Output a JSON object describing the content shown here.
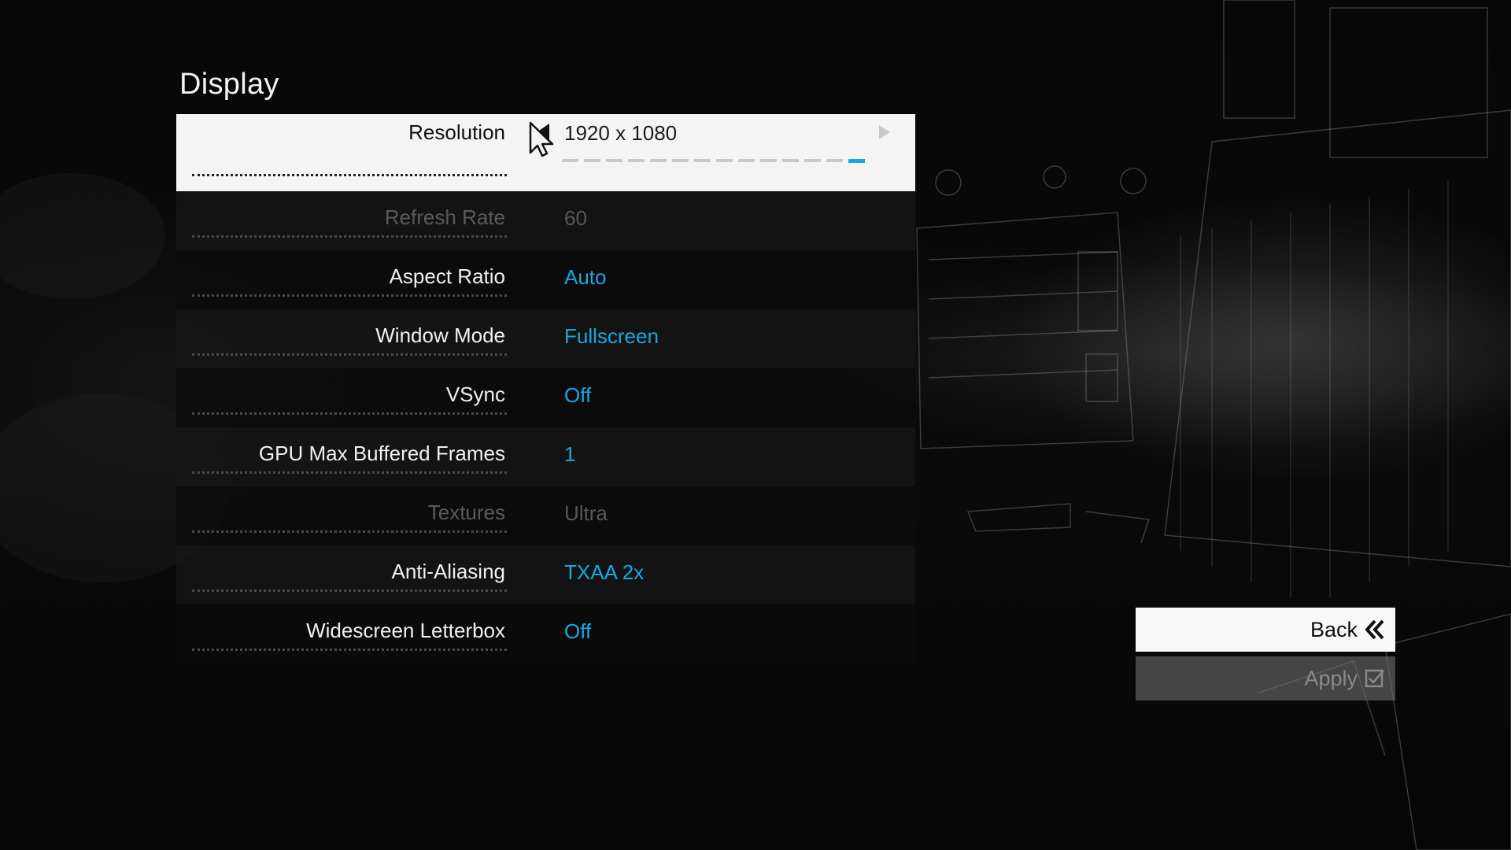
{
  "page": {
    "title": "Display"
  },
  "settings": [
    {
      "label": "Resolution",
      "value": "1920 x 1080",
      "state": "selected",
      "slider": {
        "steps": 14,
        "active_index": 13
      }
    },
    {
      "label": "Refresh Rate",
      "value": "60",
      "state": "disabled"
    },
    {
      "label": "Aspect Ratio",
      "value": "Auto",
      "state": "normal"
    },
    {
      "label": "Window Mode",
      "value": "Fullscreen",
      "state": "normal"
    },
    {
      "label": "VSync",
      "value": "Off",
      "state": "normal"
    },
    {
      "label": "GPU Max Buffered Frames",
      "value": "1",
      "state": "normal"
    },
    {
      "label": "Textures",
      "value": "Ultra",
      "state": "disabled"
    },
    {
      "label": "Anti-Aliasing",
      "value": "TXAA 2x",
      "state": "normal"
    },
    {
      "label": "Widescreen Letterbox",
      "value": "Off",
      "state": "normal"
    }
  ],
  "actions": {
    "back_label": "Back",
    "back_icon": "double-chevron-left-icon",
    "apply_label": "Apply",
    "apply_icon": "checkbox-icon"
  },
  "colors": {
    "accent": "#1aa7e0",
    "selected_row": "#f4f4f4",
    "disabled_text": "#575757"
  }
}
